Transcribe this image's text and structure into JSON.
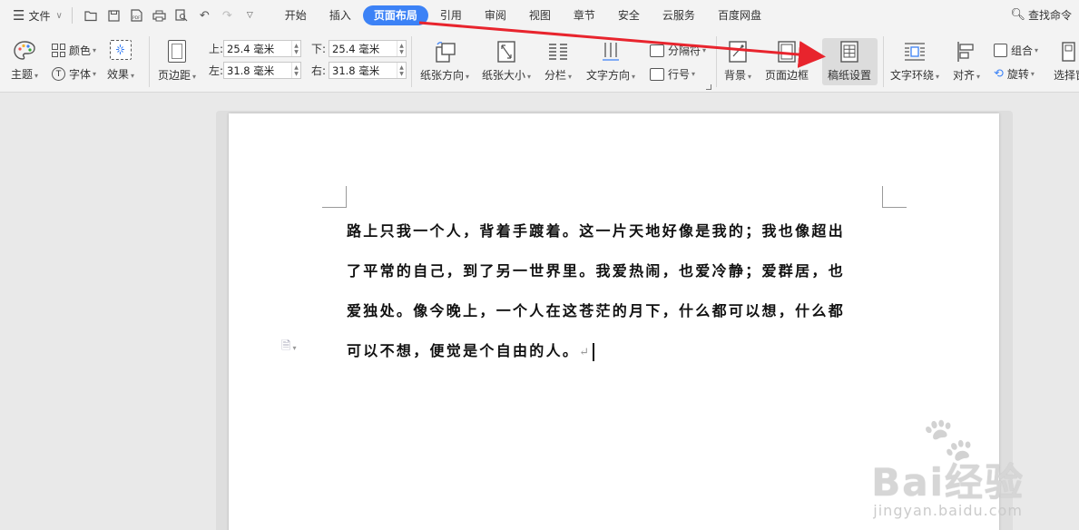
{
  "menubar": {
    "file_label": "文件",
    "tabs": [
      {
        "label": "开始"
      },
      {
        "label": "插入"
      },
      {
        "label": "页面布局",
        "active": true
      },
      {
        "label": "引用"
      },
      {
        "label": "审阅"
      },
      {
        "label": "视图"
      },
      {
        "label": "章节"
      },
      {
        "label": "安全"
      },
      {
        "label": "云服务"
      },
      {
        "label": "百度网盘"
      }
    ],
    "search_label": "查找命令",
    "accent_color": "#3c82f6"
  },
  "ribbon": {
    "theme": "主题",
    "colors": "颜色",
    "font": "字体",
    "effects": "效果",
    "margins": "页边距",
    "margin_top_label": "上:",
    "margin_top": "25.4 毫米",
    "margin_bottom_label": "下:",
    "margin_bottom": "25.4 毫米",
    "margin_left_label": "左:",
    "margin_left": "31.8 毫米",
    "margin_right_label": "右:",
    "margin_right": "31.8 毫米",
    "orientation": "纸张方向",
    "paper_size": "纸张大小",
    "columns": "分栏",
    "text_direction": "文字方向",
    "separator": "分隔符",
    "line_numbers": "行号",
    "background": "背景",
    "page_border": "页面边框",
    "manuscript": "稿纸设置",
    "text_wrap": "文字环绕",
    "align": "对齐",
    "group": "组合",
    "rotate": "旋转",
    "select_pane": "选择窗"
  },
  "document": {
    "lines": [
      "路上只我一个人，背着手踱着。这一片天地好像是我的；我也像超出",
      "了平常的自己，到了另一世界里。我爱热闹，也爱冷静；爱群居，也",
      "爱独处。像今晚上，一个人在这苍茫的月下，什么都可以想，什么都",
      "可以不想，便觉是个自由的人。"
    ],
    "paragraph_mark": "↵"
  },
  "watermark": {
    "brand": "Bai经验",
    "url": "jingyan.baidu.com"
  }
}
